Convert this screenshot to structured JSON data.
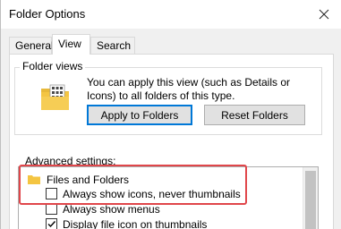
{
  "window": {
    "title": "Folder Options",
    "close_icon": "close-icon"
  },
  "tabs": [
    {
      "label": "General",
      "active": false
    },
    {
      "label": "View",
      "active": true
    },
    {
      "label": "Search",
      "active": false
    }
  ],
  "folder_views": {
    "group_label": "Folder views",
    "description": "You can apply this view (such as Details or Icons) to all folders of this type.",
    "icon": "folder-grid-icon",
    "apply_button": "Apply to Folders",
    "reset_button": "Reset Folders"
  },
  "advanced": {
    "label": "Advanced settings:",
    "category": {
      "label": "Files and Folders",
      "icon": "folder-icon"
    },
    "items": [
      {
        "label": "Always show icons, never thumbnails",
        "checked": false
      },
      {
        "label": "Always show menus",
        "checked": false
      },
      {
        "label": "Display file icon on thumbnails",
        "checked": true
      }
    ]
  },
  "colors": {
    "highlight": "#e0464a",
    "accent": "#0078d7",
    "folder": "#f4c542"
  }
}
